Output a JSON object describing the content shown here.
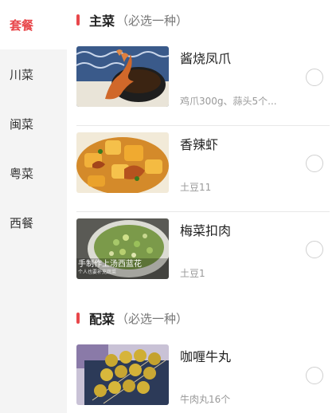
{
  "sidebar": {
    "items": [
      {
        "label": "套餐"
      },
      {
        "label": "川菜"
      },
      {
        "label": "闽菜"
      },
      {
        "label": "粤菜"
      },
      {
        "label": "西餐"
      }
    ]
  },
  "sections": [
    {
      "title": "主菜",
      "subtitle": "（必选一种）",
      "dishes": [
        {
          "name": "酱烧凤爪",
          "desc": "鸡爪300g、蒜头5个..."
        },
        {
          "name": "香辣虾",
          "desc": "土豆11"
        },
        {
          "name": "梅菜扣肉",
          "desc": "土豆1",
          "thumb_caption": "手制作上汤西蓝花",
          "thumb_caption_small": "个人也要补充蔬菜"
        }
      ]
    },
    {
      "title": "配菜",
      "subtitle": "（必选一种）",
      "dishes": [
        {
          "name": "咖喱牛丸",
          "desc": "牛肉丸16个"
        }
      ]
    }
  ],
  "colors": {
    "accent": "#e8474b",
    "sidebar_bg": "#f4f4f4",
    "divider": "#e8e8e8"
  }
}
